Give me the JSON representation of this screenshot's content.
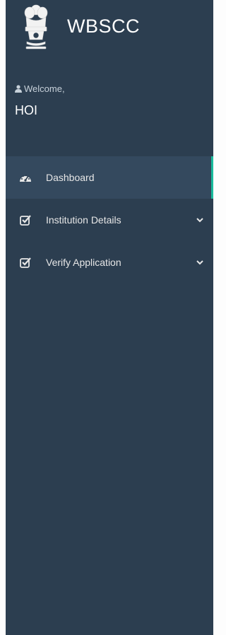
{
  "brand": {
    "title": "WBSCC",
    "emblem_icon": "national-emblem-icon"
  },
  "user": {
    "welcome_label": "Welcome,",
    "name": "HOI"
  },
  "nav": {
    "items": [
      {
        "label": "Dashboard",
        "icon": "dashboard-icon",
        "active": true,
        "has_submenu": false
      },
      {
        "label": "Institution Details",
        "icon": "checkbox-icon",
        "active": false,
        "has_submenu": true
      },
      {
        "label": "Verify Application",
        "icon": "checkbox-icon",
        "active": false,
        "has_submenu": true
      }
    ]
  },
  "colors": {
    "sidebar_bg": "#2c3e50",
    "active_item_bg": "#34495e",
    "active_indicator": "#1abb9c"
  }
}
